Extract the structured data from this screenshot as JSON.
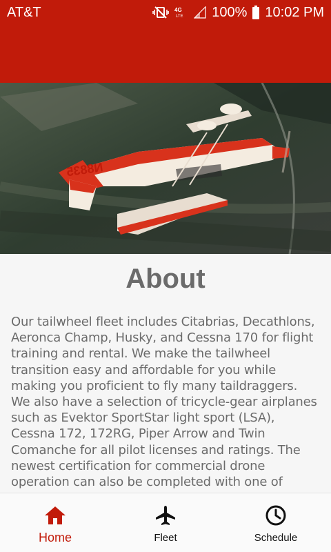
{
  "status_bar": {
    "carrier": "AT&T",
    "network": "4G LTE",
    "battery": "100%",
    "time": "10:02 PM"
  },
  "hero": {
    "tail_number": "N8835"
  },
  "about": {
    "title": "About",
    "body": "Our tailwheel fleet includes Citabrias, Decathlons, Aeronca Champ, Husky, and Cessna 170 for flight training and rental. We make the tailwheel transition easy and affordable for you while making you proficient to fly many taildraggers. We also have a selection of tricycle-gear airplanes such as Evektor SportStar light sport (LSA), Cessna 172, 172RG, Piper Arrow and Twin Comanche for all pilot licenses and ratings. The newest certification for commercial drone operation can also be completed with one of"
  },
  "bottom_nav": {
    "items": [
      {
        "label": "Home",
        "icon": "home-icon",
        "active": true
      },
      {
        "label": "Fleet",
        "icon": "airplane-icon",
        "active": false
      },
      {
        "label": "Schedule",
        "icon": "clock-icon",
        "active": false
      }
    ]
  },
  "colors": {
    "brand": "#c11b0a",
    "text": "#6b6b6b"
  }
}
